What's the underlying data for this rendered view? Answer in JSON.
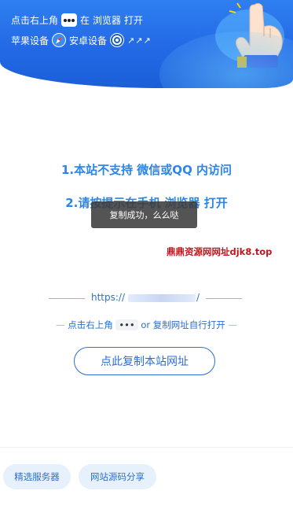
{
  "banner": {
    "line1": {
      "prefix": "点击右上角",
      "after_dots": "在",
      "browser": "浏览器",
      "open": "打开"
    },
    "line2": {
      "apple": "苹果设备",
      "android": "安卓设备",
      "arrows": "↗↗↗"
    }
  },
  "warnings": {
    "w1": "1.本站不支持 微信或QQ 内访问",
    "w2": "2.请按提示在手机 浏览器 打开"
  },
  "toast": "复制成功，么么哒",
  "watermark": "鼎鼎资源网网址djk8.top",
  "url": {
    "prefix": "https://",
    "suffix": "/"
  },
  "hint": {
    "left_dash": "—",
    "prefix": "点击右上角",
    "dots": "•••",
    "or": "or",
    "suffix": "复制网址自行打开",
    "right_dash": "—"
  },
  "copy_button": "点此复制本站网址",
  "bottom": {
    "servers": "精选服务器",
    "source": "网站源码分享"
  },
  "colors": {
    "accent": "#2a86e8",
    "banner": "#2369e6",
    "watermark": "#c0161d"
  }
}
